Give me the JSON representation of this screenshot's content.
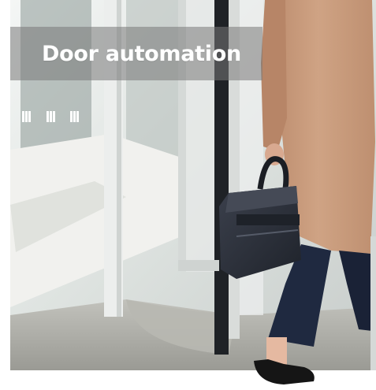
{
  "caption": {
    "title": "Door automation"
  },
  "colors": {
    "coat": "#c89b7b",
    "trousers": "#1f2940",
    "bag": "#2f3440",
    "floor": "#a9a9a3",
    "glass": "#dfe4e1",
    "caption_overlay": "#787878"
  },
  "photo": {
    "subject": "photo-woman-walking-through-revolving-glass-door"
  }
}
